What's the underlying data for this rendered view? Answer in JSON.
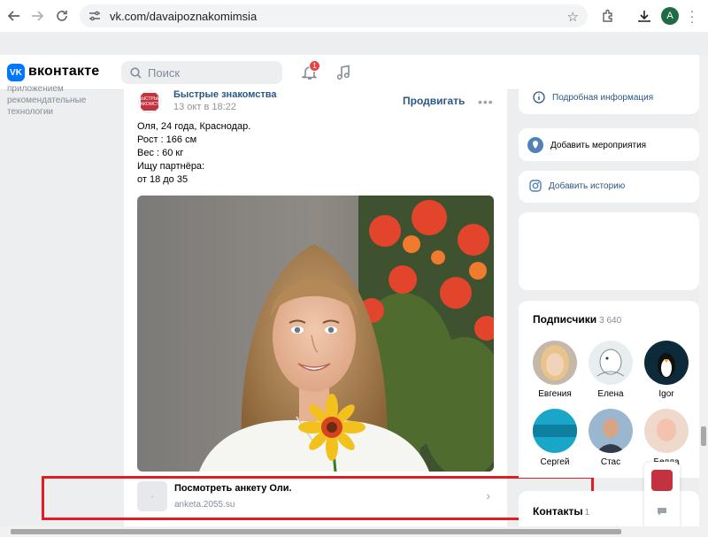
{
  "browser": {
    "url": "vk.com/davaipoznakomimsia",
    "profile_initial": "A"
  },
  "header": {
    "logo_text": "VK",
    "site_name": "вконтакте",
    "search_placeholder": "Поиск",
    "notifications_count": "1"
  },
  "sidebar": {
    "note_lines": [
      "приложением",
      "рекомендательные",
      "технологии"
    ]
  },
  "post": {
    "community_name": "Быстрые знакомства",
    "community_logo_text": "БЫСТРЫЕ ЗНАКОМСТВА",
    "date": "13 окт в 18:22",
    "promote_label": "Продвигать",
    "text_lines": [
      "Оля, 24 года, Краснодар.",
      "Рост : 166 см",
      "Вес : 60 кг",
      "Ищу партнёра:",
      "от 18 до 35"
    ],
    "link": {
      "title": "Посмотреть анкету Оли.",
      "domain": "anketa.2055.su"
    }
  },
  "right": {
    "info_label": "Подробная информация",
    "event_label": "Добавить мероприятия",
    "story_label": "Добавить историю",
    "subscribers_title": "Подписчики",
    "subscribers_count": "3 640",
    "subscribers": [
      {
        "name": "Евгения"
      },
      {
        "name": "Елена"
      },
      {
        "name": "Igor"
      },
      {
        "name": "Сергей"
      },
      {
        "name": "Стас"
      },
      {
        "name": "Белла"
      }
    ],
    "contacts_title": "Контакты",
    "contacts_count": "1"
  },
  "colors": {
    "vk_blue": "#0077ff",
    "link_blue": "#2a5885",
    "highlight_red": "#e31c23"
  }
}
